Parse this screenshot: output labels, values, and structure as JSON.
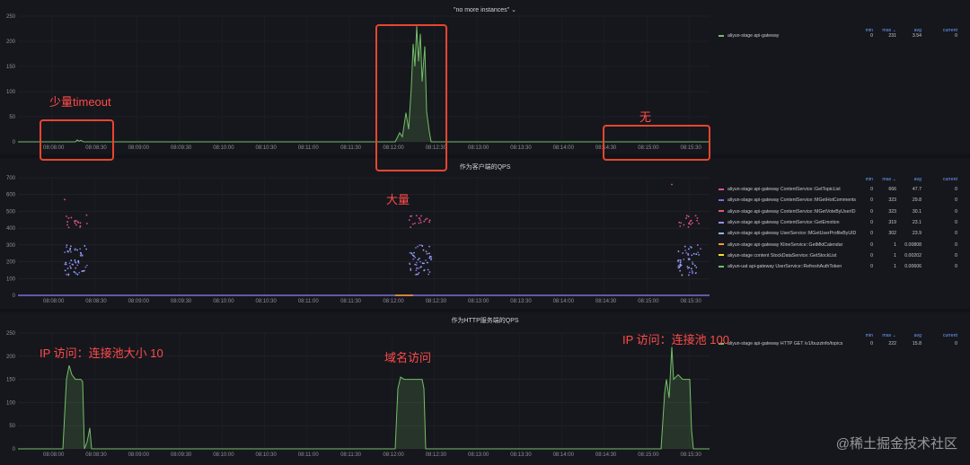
{
  "panels": [
    {
      "title": "\"no more instances\" ⌄",
      "y_ticks": [
        "250",
        "200",
        "150",
        "100",
        "50",
        "0"
      ],
      "x_ticks": [
        "08:08:00",
        "08:08:30",
        "08:09:00",
        "08:09:30",
        "08:10:00",
        "08:10:30",
        "08:11:00",
        "08:11:30",
        "08:12:00",
        "08:12:30",
        "08:13:00",
        "08:13:30",
        "08:14:00",
        "08:14:30",
        "08:15:00",
        "08:15:30"
      ],
      "legend_headers": [
        "min",
        "max ⌄",
        "avg",
        "current"
      ],
      "legend": [
        {
          "name": "aliyun-stage api-gateway",
          "color": "#73bf69",
          "min": "0",
          "max": "231",
          "avg": "3.54",
          "current": "0"
        }
      ]
    },
    {
      "title": "作为客户端的QPS",
      "y_ticks": [
        "700",
        "600",
        "500",
        "400",
        "300",
        "200",
        "100",
        "0"
      ],
      "x_ticks": [
        "08:08:00",
        "08:08:30",
        "08:09:00",
        "08:09:30",
        "08:10:00",
        "08:10:30",
        "08:11:00",
        "08:11:30",
        "08:12:00",
        "08:12:30",
        "08:13:00",
        "08:13:30",
        "08:14:00",
        "08:14:30",
        "08:15:00",
        "08:15:30"
      ],
      "legend_headers": [
        "min",
        "max ⌄",
        "avg",
        "current"
      ],
      "legend": [
        {
          "name": "aliyun-stage api-gateway ContentService::GetTopicList",
          "color": "#d94f9a",
          "min": "0",
          "max": "666",
          "avg": "47.7",
          "current": "0"
        },
        {
          "name": "aliyun-stage api-gateway ContentService::MGetHotComments",
          "color": "#7b6fd8",
          "min": "0",
          "max": "323",
          "avg": "29.8",
          "current": "0"
        },
        {
          "name": "aliyun-stage api-gateway ContentService::MGetVoteByUserID",
          "color": "#e05b78",
          "min": "0",
          "max": "323",
          "avg": "30.1",
          "current": "0"
        },
        {
          "name": "aliyun-stage api-gateway ContentService::GetEmotion",
          "color": "#a18cf0",
          "min": "0",
          "max": "319",
          "avg": "23.1",
          "current": "0"
        },
        {
          "name": "aliyun-stage api-gateway UserService::MGetUserProfileByUID",
          "color": "#8ab8ff",
          "min": "0",
          "max": "302",
          "avg": "23.9",
          "current": "0"
        },
        {
          "name": "aliyun-stage api-gateway KlineService::GetMktCalendar",
          "color": "#ff9830",
          "min": "0",
          "max": "1",
          "avg": "0.00808",
          "current": "0"
        },
        {
          "name": "aliyun-stage content StockDataService::GetStockList",
          "color": "#fade2a",
          "min": "0",
          "max": "1",
          "avg": "0.00202",
          "current": "0"
        },
        {
          "name": "aliyun-uat api-gateway UserService::RefreshAuthToken",
          "color": "#73bf69",
          "min": "0",
          "max": "1",
          "avg": "0.00606",
          "current": "0"
        }
      ]
    },
    {
      "title": "作为HTTP服务端的QPS",
      "y_ticks": [
        "250",
        "200",
        "150",
        "100",
        "50",
        "0"
      ],
      "x_ticks": [
        "08:08:00",
        "08:08:30",
        "08:09:00",
        "08:09:30",
        "08:10:00",
        "08:10:30",
        "08:11:00",
        "08:11:30",
        "08:12:00",
        "08:12:30",
        "08:13:00",
        "08:13:30",
        "08:14:00",
        "08:14:30",
        "08:15:00",
        "08:15:30"
      ],
      "legend_headers": [
        "min",
        "max ⌄",
        "avg",
        "current"
      ],
      "legend": [
        {
          "name": "aliyun-stage api-gateway HTTP GET /v1/buzzinfo/topics",
          "color": "#73bf69",
          "min": "0",
          "max": "222",
          "avg": "15.8",
          "current": "0"
        }
      ]
    }
  ],
  "annotations": {
    "few_timeout": "少量timeout",
    "none": "无",
    "many": "大量",
    "ip_pool_10": "IP 访问：连接池大小 10",
    "domain_access": "域名访问",
    "ip_pool_100": "IP 访问：连接池 100"
  },
  "watermark": "@稀土掘金技术社区",
  "colors": {
    "accent_line": "#73bf69",
    "annotation_red": "#e8452f"
  }
}
